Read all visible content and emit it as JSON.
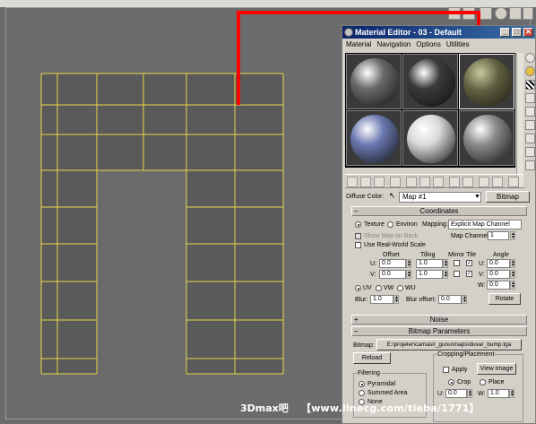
{
  "material_editor": {
    "title": "Material Editor - 03 - Default",
    "window_buttons": {
      "minimize": "_",
      "maximize": "□",
      "close": "✕"
    },
    "menus": [
      "Material",
      "Navigation",
      "Options",
      "Utilities"
    ],
    "spheres": [
      {
        "name": "dark-gray",
        "color": "#6a6a6a"
      },
      {
        "name": "black",
        "color": "#3a3a3a"
      },
      {
        "name": "stone-textured",
        "color": "#5e5e40"
      },
      {
        "name": "blue",
        "color": "#6a78b0"
      },
      {
        "name": "white",
        "color": "#d8d8d8"
      },
      {
        "name": "gray",
        "color": "#8a8a8a"
      }
    ],
    "diffuse_label": "Diffuse Color:",
    "map_name": "Map #1",
    "type_button": "Bitmap",
    "coordinates": {
      "header": "Coordinates",
      "texture": "Texture",
      "environ": "Environ",
      "mapping_label": "Mapping:",
      "mapping_value": "Explicit Map Channel",
      "show_map_on_back": "Show Map on Back",
      "map_channel_label": "Map Channel:",
      "map_channel_value": "1",
      "use_real_world": "Use Real-World Scale",
      "offset": "Offset",
      "tiling": "Tiling",
      "mirror_tile": "Mirror Tile",
      "angle": "Angle",
      "u": "U:",
      "v": "V:",
      "w": "W:",
      "u_offset": "0.0",
      "v_offset": "0.0",
      "u_tiling": "1.0",
      "v_tiling": "1.0",
      "u_angle": "0.0",
      "v_angle": "0.0",
      "w_angle": "0.0",
      "uv": "UV",
      "vw": "VW",
      "wu": "WU",
      "blur_label": "Blur:",
      "blur_value": "1.0",
      "blur_offset_label": "Blur offset:",
      "blur_offset_value": "0.0",
      "rotate": "Rotate"
    },
    "noise_header": "Noise",
    "bitmap_params": {
      "header": "Bitmap Parameters",
      "bitmap_label": "Bitmap:",
      "bitmap_path": "E:\\projeler\\camasir_gunu\\maps\\duvar_bump.tga",
      "reload": "Reload",
      "cropping": "Cropping/Placement",
      "apply": "Apply",
      "view_image": "View Image",
      "crop": "Crop",
      "place": "Place",
      "u_label": "U:",
      "u_value": "0.0",
      "w_label": "W:",
      "w_value": "1.0",
      "filtering": "Filtering",
      "pyramidal": "Pyramidal",
      "summed_area": "Summed Area",
      "none": "None"
    }
  },
  "watermark": {
    "brand": "3Dmax吧",
    "url": "【www.linecg.com/tieba/1771】"
  },
  "colors": {
    "viewport": "#6b6b6b",
    "wireframe": "#e8d84a",
    "annotation": "#ff0000",
    "titlebar": "#0a246a"
  }
}
